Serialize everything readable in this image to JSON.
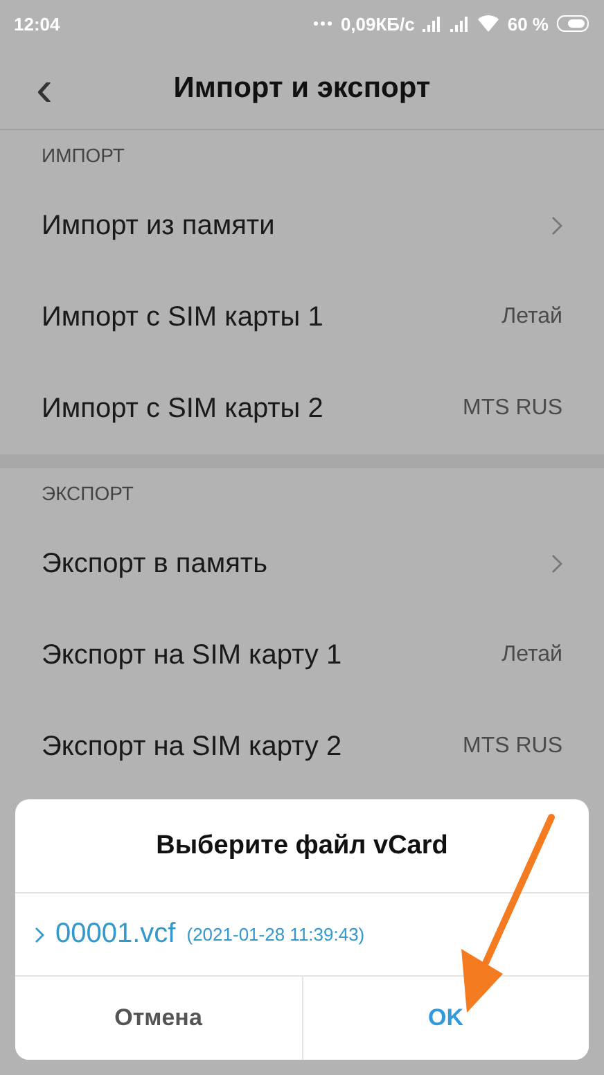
{
  "status_bar": {
    "time": "12:04",
    "speed": "0,09КБ/с",
    "battery": "60 %"
  },
  "header": {
    "back": "‹",
    "title": "Импорт и экспорт"
  },
  "sections": [
    {
      "title": "ИМПОРТ",
      "rows": [
        {
          "label": "Импорт из памяти",
          "kind": "chevron"
        },
        {
          "label": "Импорт с SIM карты 1",
          "kind": "value",
          "value": "Летай"
        },
        {
          "label": "Импорт с SIM карты 2",
          "kind": "value",
          "value": "MTS RUS"
        }
      ]
    },
    {
      "title": "ЭКСПОРТ",
      "rows": [
        {
          "label": "Экспорт в память",
          "kind": "chevron"
        },
        {
          "label": "Экспорт на SIM карту 1",
          "kind": "value",
          "value": "Летай"
        },
        {
          "label": "Экспорт на SIM карту 2",
          "kind": "value",
          "value": "MTS RUS"
        }
      ]
    }
  ],
  "dialog": {
    "title": "Выберите файл vCard",
    "files": [
      {
        "name": "00001.vcf",
        "date": "(2021-01-28 11:39:43)"
      }
    ],
    "cancel": "Отмена",
    "ok": "OK"
  }
}
